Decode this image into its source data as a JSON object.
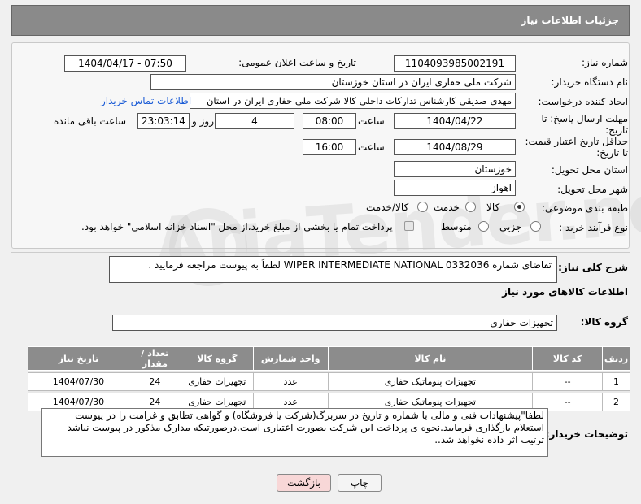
{
  "header": {
    "title": "جزئیات اطلاعات نیاز"
  },
  "form": {
    "need_number": {
      "label": "شماره نیاز:",
      "value": "1104093985002191"
    },
    "announce": {
      "label": "تاریخ و ساعت اعلان عمومی:",
      "value": "1404/04/17 - 07:50"
    },
    "buyer_org": {
      "label": "نام دستگاه خریدار:",
      "value": "شرکت ملی حفاری ایران در استان خوزستان"
    },
    "creator": {
      "label": "ایجاد کننده درخواست:",
      "value": "مهدی صدیقی کارشناس تدارکات داخلی کالا شرکت ملی حفاری ایران در استان",
      "link": "اطلاعات تماس خریدار"
    },
    "deadline": {
      "label_line1": "مهلت ارسال پاسخ: تا",
      "label_line2": "تاریخ:",
      "date": "1404/04/22",
      "time_label": "ساعت",
      "time": "08:00",
      "days": "4",
      "days_label": "روز و",
      "remaining": "23:03:14",
      "remaining_label": "ساعت باقی مانده"
    },
    "validity": {
      "label_line1": "حداقل تاریخ اعتبار قیمت:",
      "label_line2": "تا تاریخ:",
      "date": "1404/08/29",
      "time_label": "ساعت",
      "time": "16:00"
    },
    "province": {
      "label": "استان محل تحویل:",
      "value": "خوزستان"
    },
    "city": {
      "label": "شهر محل تحویل:",
      "value": "اهواز"
    },
    "category": {
      "label": "طبقه بندی موضوعی:",
      "options": [
        "کالا",
        "خدمت",
        "کالا/خدمت"
      ],
      "selected": "کالا"
    },
    "process": {
      "label": "نوع فرآیند خرید :",
      "options": [
        "جزیی",
        "متوسط"
      ],
      "selected": "",
      "note": "پرداخت تمام یا بخشی از مبلغ خرید،از محل \"اسناد خزانه اسلامی\" خواهد بود."
    }
  },
  "summary": {
    "label": "شرح کلی نیاز:",
    "value": "تقاضای شماره WIPER INTERMEDIATE NATIONAL 0332036 لطفاً به پیوست مراجعه فرمایید ."
  },
  "goods_section": {
    "title": "اطلاعات کالاهای مورد نیاز"
  },
  "goods_group": {
    "label": "گروه کالا:",
    "value": "تجهیزات حفاری"
  },
  "table": {
    "headers": [
      "ردیف",
      "کد کالا",
      "نام کالا",
      "واحد شمارش",
      "گروه کالا",
      "تعداد / مقدار",
      "تاریخ نیاز"
    ],
    "rows": [
      [
        "1",
        "--",
        "تجهیزات پنوماتیک حفاری",
        "عدد",
        "تجهیزات حفاری",
        "24",
        "1404/07/30"
      ],
      [
        "2",
        "--",
        "تجهیزات پنوماتیک حفاری",
        "عدد",
        "تجهیزات حفاری",
        "24",
        "1404/07/30"
      ]
    ]
  },
  "buyer_notes": {
    "label": "توضیحات خریدار:",
    "value": "لطفا\"پیشنهادات فنی و مالی با شماره و تاریخ در سربرگ(شرکت یا فروشگاه) و گواهی تطابق و غرامت را در پیوست استعلام بارگذاری فرمایید.نحوه ی پرداخت این شرکت بصورت اعتباری است.درصورتیکه مدارک مذکور در پیوست نباشد ترتیب اثر داده نخواهد شد.."
  },
  "buttons": {
    "print": "چاپ",
    "back": "بازگشت"
  },
  "watermark": {
    "text": "AriaTender.net"
  },
  "colors": {
    "header_bg": "#8a8a8a",
    "link": "#1a5bd6",
    "back_button": "#f8d7d7"
  }
}
